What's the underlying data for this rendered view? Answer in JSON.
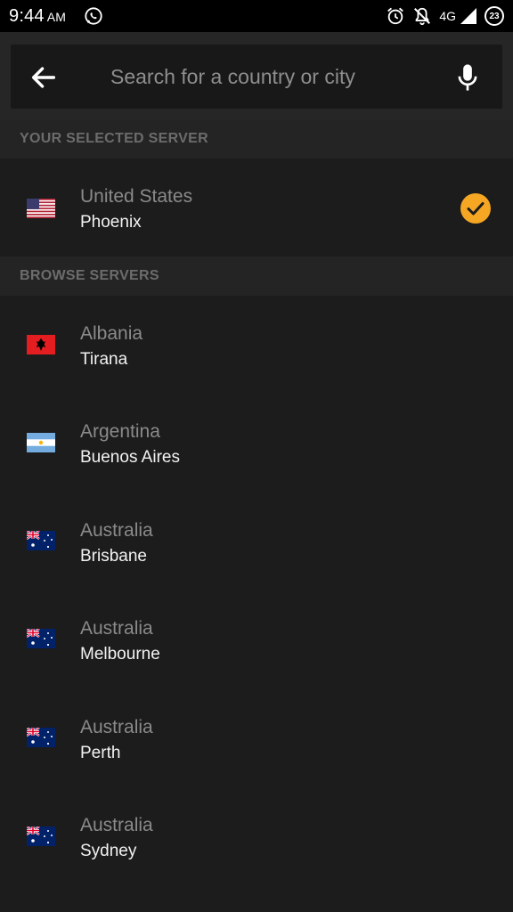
{
  "status_bar": {
    "time": "9:44",
    "ampm": "AM",
    "network": "4G",
    "battery": "23"
  },
  "search": {
    "placeholder": "Search for a country or city",
    "value": ""
  },
  "selected_section": {
    "title": "YOUR SELECTED SERVER",
    "server": {
      "country": "United States",
      "city": "Phoenix",
      "flag": "us-flag-icon",
      "selected": true
    }
  },
  "browse_section": {
    "title": "BROWSE SERVERS",
    "servers": [
      {
        "country": "Albania",
        "city": "Tirana",
        "flag": "albania-flag-icon"
      },
      {
        "country": "Argentina",
        "city": "Buenos Aires",
        "flag": "argentina-flag-icon"
      },
      {
        "country": "Australia",
        "city": "Brisbane",
        "flag": "australia-flag-icon"
      },
      {
        "country": "Australia",
        "city": "Melbourne",
        "flag": "australia-flag-icon"
      },
      {
        "country": "Australia",
        "city": "Perth",
        "flag": "australia-flag-icon"
      },
      {
        "country": "Australia",
        "city": "Sydney",
        "flag": "australia-flag-icon"
      }
    ]
  },
  "colors": {
    "accent": "#f5a623",
    "background": "#1c1c1c",
    "section_background": "#242424"
  }
}
